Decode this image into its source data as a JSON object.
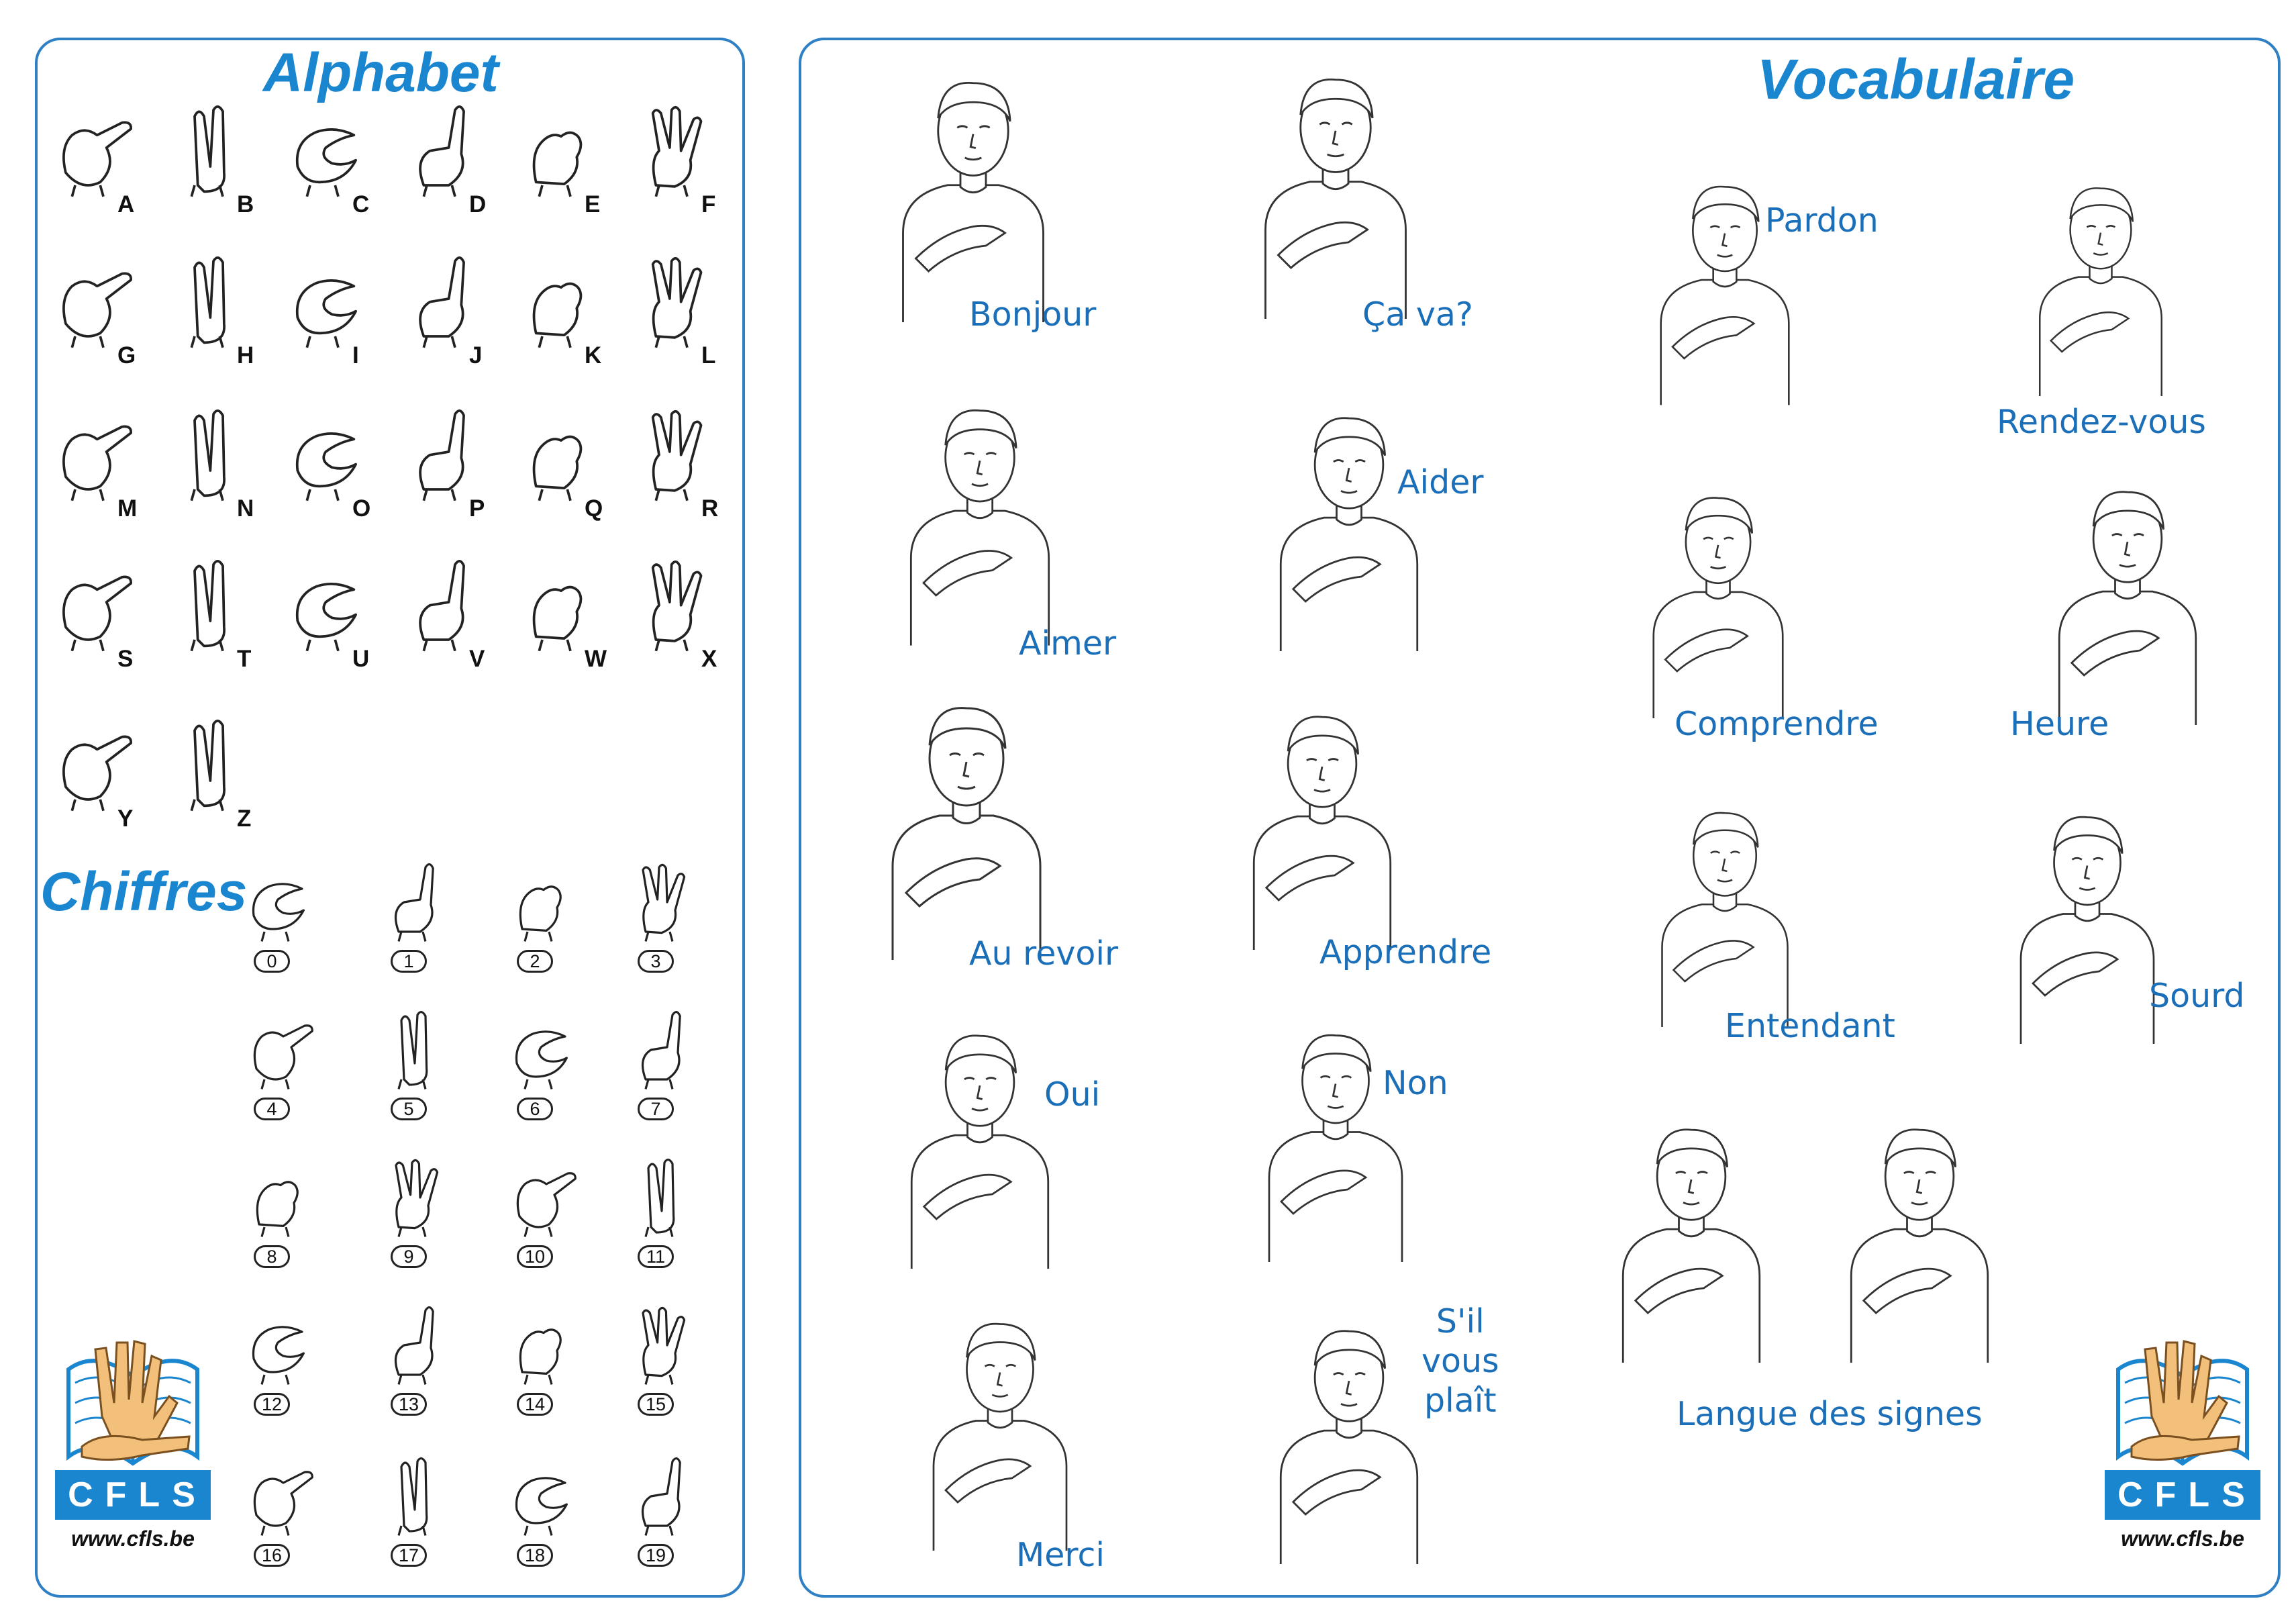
{
  "left": {
    "alphabet_title": "Alphabet",
    "letters": [
      "A",
      "B",
      "C",
      "D",
      "E",
      "F",
      "G",
      "H",
      "I",
      "J",
      "K",
      "L",
      "M",
      "N",
      "O",
      "P",
      "Q",
      "R",
      "S",
      "T",
      "U",
      "V",
      "W",
      "X",
      "Y",
      "Z"
    ],
    "digits_title": "Chiffres",
    "numbers": [
      "0",
      "1",
      "2",
      "3",
      "4",
      "5",
      "6",
      "7",
      "8",
      "9",
      "10",
      "11",
      "12",
      "13",
      "14",
      "15",
      "16",
      "17",
      "18",
      "19"
    ]
  },
  "right": {
    "vocab_title": "Vocabulaire",
    "words": [
      "Bonjour",
      "Ça va?",
      "Pardon",
      "Rendez-vous",
      "Aimer",
      "Aider",
      "Comprendre",
      "Heure",
      "Au revoir",
      "Apprendre",
      "Entendant",
      "Sourd",
      "Oui",
      "Non",
      "Langue des signes",
      "Merci",
      "S'il\nvous\nplaît"
    ]
  },
  "logo": {
    "brand": "CFLS",
    "url": "www.cfls.be"
  },
  "colors": {
    "accent": "#1a86cf",
    "label": "#1b6fb8",
    "line": "#222222",
    "hand": "#f2c07a"
  }
}
